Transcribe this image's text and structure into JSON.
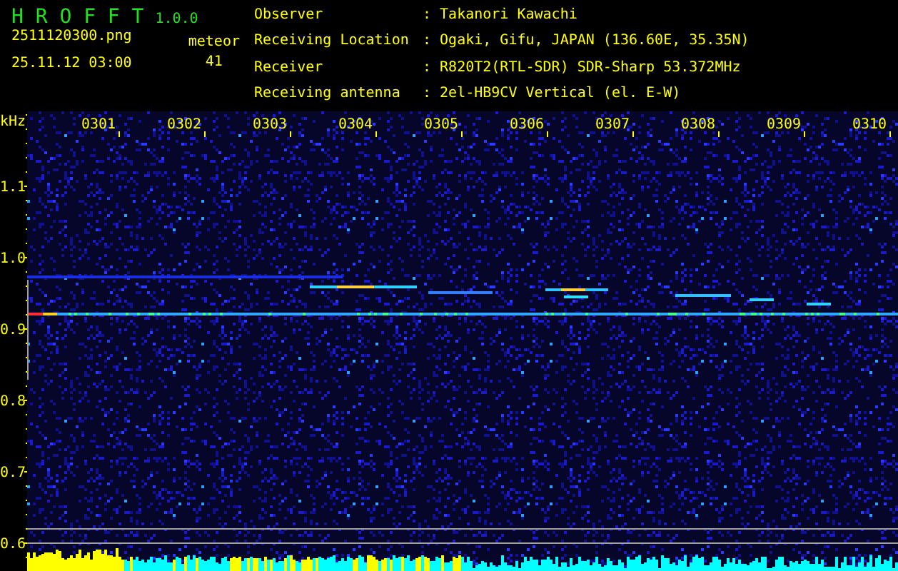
{
  "app": {
    "name": "H R O F F T",
    "version": "1.0.0",
    "file": "2511120300.png",
    "datetime": "25.11.12 03:00",
    "count_label": "meteor",
    "count": "41"
  },
  "info": [
    {
      "label": "Observer",
      "value": ": Takanori Kawachi"
    },
    {
      "label": "Receiving Location",
      "value": ": Ogaki, Gifu, JAPAN (136.60E, 35.35N)"
    },
    {
      "label": "Receiver",
      "value": ": R820T2(RTL-SDR) SDR-Sharp 53.372MHz"
    },
    {
      "label": "Receiving antenna",
      "value": ": 2el-HB9CV Vertical (el. E-W)"
    }
  ],
  "spectrogram": {
    "unit": "kHz",
    "x_labels": [
      "0301",
      "0302",
      "0303",
      "0304",
      "0305",
      "0306",
      "0307",
      "0308",
      "0309",
      "0310"
    ],
    "y_labels": [
      "1.1",
      "1.0",
      "0.9",
      "0.8",
      "0.7",
      "0.6"
    ]
  }
}
